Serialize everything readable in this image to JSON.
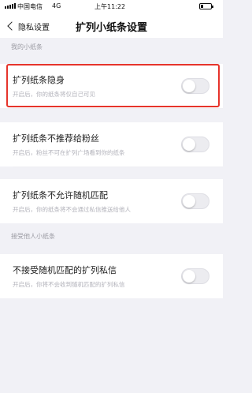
{
  "status_bar": {
    "carrier": "中国电信",
    "network": "4G",
    "time": "上午11:22"
  },
  "nav": {
    "back_label": "隐私设置",
    "title": "扩列小纸条设置"
  },
  "sections": [
    {
      "header": "我的小纸条",
      "items": [
        {
          "label": "扩列纸条隐身",
          "desc": "开启后，你的纸条将仅自己可见",
          "enabled": false
        },
        {
          "label": "扩列纸条不推荐给粉丝",
          "desc": "开启后，粉丝不可在扩列广场看到你的纸条",
          "enabled": false
        },
        {
          "label": "扩列纸条不允许随机匹配",
          "desc": "开启后，你的纸条将不会通过私信推送给他人",
          "enabled": false
        }
      ]
    },
    {
      "header": "接受他人小纸条",
      "items": [
        {
          "label": "不接受随机匹配的扩列私信",
          "desc": "开启后，你将不会收到随机匹配的扩列私信",
          "enabled": false
        }
      ]
    }
  ],
  "colors": {
    "highlight": "#e6342b",
    "background": "#f1f1f6"
  }
}
